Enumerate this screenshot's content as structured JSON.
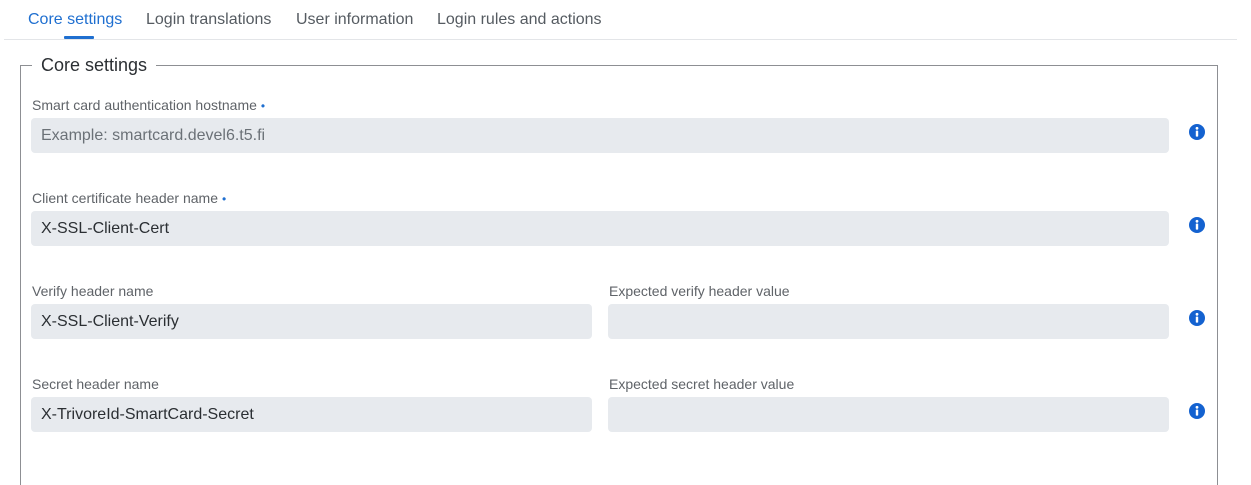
{
  "tabs": [
    {
      "label": "Core settings",
      "active": true
    },
    {
      "label": "Login translations",
      "active": false
    },
    {
      "label": "User information",
      "active": false
    },
    {
      "label": "Login rules and actions",
      "active": false
    }
  ],
  "section": {
    "title": "Core settings"
  },
  "fields": {
    "hostname": {
      "label": "Smart card authentication hostname",
      "required_mark": "•",
      "value": "",
      "placeholder": "Example: smartcard.devel6.t5.fi"
    },
    "cert_header": {
      "label": "Client certificate header name",
      "required_mark": "•",
      "value": "X-SSL-Client-Cert",
      "placeholder": ""
    },
    "verify_header": {
      "label": "Verify header name",
      "value": "X-SSL-Client-Verify",
      "placeholder": ""
    },
    "expected_verify": {
      "label": "Expected verify header value",
      "value": "",
      "placeholder": ""
    },
    "secret_header": {
      "label": "Secret header name",
      "value": "X-TrivoreId-SmartCard-Secret",
      "placeholder": ""
    },
    "expected_secret": {
      "label": "Expected secret header value",
      "value": "",
      "placeholder": ""
    }
  },
  "icons": {
    "info": "info-icon"
  },
  "colors": {
    "accent": "#1f6fd0",
    "input_bg": "#e7eaee",
    "info_icon": "#1462d0"
  }
}
